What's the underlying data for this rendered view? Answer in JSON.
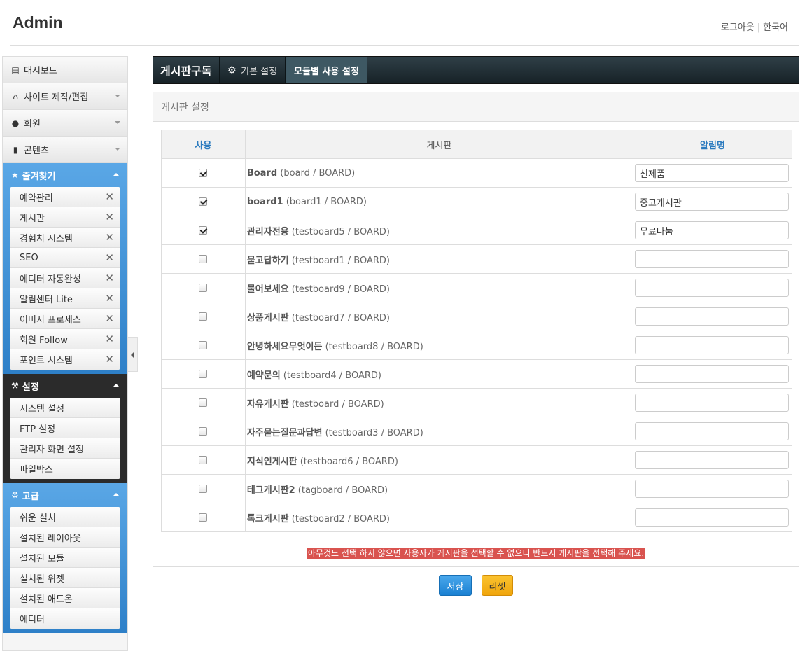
{
  "header": {
    "title": "Admin",
    "logout": "로그아웃",
    "separator": "|",
    "language": "한국어"
  },
  "sidebar": {
    "nav": [
      {
        "label": "대시보드",
        "icon": "dashboard-icon"
      },
      {
        "label": "사이트 제작/편집",
        "icon": "home-icon"
      },
      {
        "label": "회원",
        "icon": "user-icon"
      },
      {
        "label": "콘텐츠",
        "icon": "document-icon"
      }
    ],
    "favorites": {
      "title": "즐겨찾기",
      "items": [
        "예약관리",
        "게시판",
        "경험치 시스템",
        "SEO",
        "에디터 자동완성",
        "알림센터 Lite",
        "이미지 프로세스",
        "회원 Follow",
        "포인트 시스템"
      ]
    },
    "settings": {
      "title": "설정",
      "items": [
        "시스템 설정",
        "FTP 설정",
        "관리자 화면 설정",
        "파일박스"
      ]
    },
    "advanced": {
      "title": "고급",
      "items": [
        "쉬운 설치",
        "설치된 레이아웃",
        "설치된 모듈",
        "설치된 위젯",
        "설치된 애드온",
        "에디터"
      ]
    }
  },
  "tabs": {
    "title": "게시판구독",
    "basic": "기본 설정",
    "module": "모듈별 사용 설정"
  },
  "panel": {
    "title": "게시판 설정",
    "columns": {
      "use": "사용",
      "board": "게시판",
      "alias": "알림명"
    },
    "rows": [
      {
        "checked": true,
        "name": "Board",
        "meta": " (board / BOARD)",
        "alias": "신제품"
      },
      {
        "checked": true,
        "name": "board1",
        "meta": " (board1 / BOARD)",
        "alias": "중고게시판"
      },
      {
        "checked": true,
        "name": "관리자전용",
        "meta": " (testboard5 / BOARD)",
        "alias": "무료나눔"
      },
      {
        "checked": false,
        "name": "묻고답하기",
        "meta": " (testboard1 / BOARD)",
        "alias": ""
      },
      {
        "checked": false,
        "name": "물어보세요",
        "meta": " (testboard9 / BOARD)",
        "alias": ""
      },
      {
        "checked": false,
        "name": "상품게시판",
        "meta": " (testboard7 / BOARD)",
        "alias": ""
      },
      {
        "checked": false,
        "name": "안녕하세요무엇이든",
        "meta": " (testboard8 / BOARD)",
        "alias": ""
      },
      {
        "checked": false,
        "name": "예약문의",
        "meta": " (testboard4 / BOARD)",
        "alias": ""
      },
      {
        "checked": false,
        "name": "자유게시판",
        "meta": " (testboard / BOARD)",
        "alias": ""
      },
      {
        "checked": false,
        "name": "자주묻는질문과답변",
        "meta": " (testboard3 / BOARD)",
        "alias": ""
      },
      {
        "checked": false,
        "name": "지식인게시판",
        "meta": " (testboard6 / BOARD)",
        "alias": ""
      },
      {
        "checked": false,
        "name": "테그게시판2",
        "meta": " (tagboard / BOARD)",
        "alias": ""
      },
      {
        "checked": false,
        "name": "톡크게시판",
        "meta": " (testboard2 / BOARD)",
        "alias": ""
      }
    ],
    "warning": "아무것도 선택 하지 않으면 사용자가 게시판을 선택할 수 없으니 반드시 게시판을 선택해 주세요."
  },
  "buttons": {
    "save": "저장",
    "reset": "리셋"
  },
  "colors": {
    "accent": "#2b7bbf",
    "warning": "#d9534f",
    "save": "#1a80d2",
    "reset": "#f0a50c",
    "tabbar": "#172227"
  }
}
